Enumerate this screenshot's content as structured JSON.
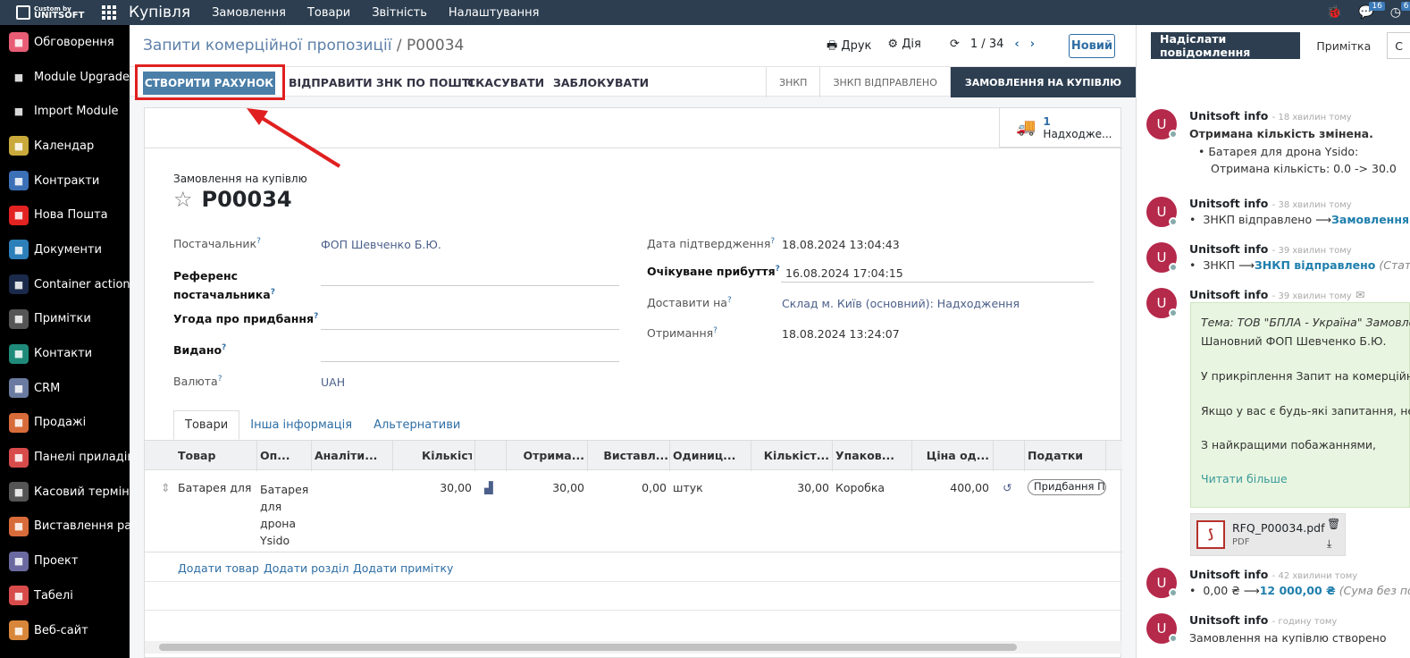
{
  "topbar": {
    "logo_small": "Custom by",
    "logo_big": "UNITSOFT",
    "app_title": "Купівля",
    "menu": [
      "Замовлення",
      "Товари",
      "Звітність",
      "Налаштування"
    ],
    "chat_count": "16",
    "activity_count": "6"
  },
  "sidebar": {
    "items": [
      {
        "label": "Обговорення",
        "icon": "discuss-icon",
        "color": "#e85d75"
      },
      {
        "label": "Module Upgrade",
        "icon": "upgrade-icon",
        "color": "#000000"
      },
      {
        "label": "Import Module",
        "icon": "import-icon",
        "color": "#000000"
      },
      {
        "label": "Календар",
        "icon": "calendar-icon",
        "color": "#c9a93b"
      },
      {
        "label": "Контракти",
        "icon": "contract-icon",
        "color": "#3b6fb6"
      },
      {
        "label": "Нова Пошта",
        "icon": "nova-poshta-icon",
        "color": "#e32222"
      },
      {
        "label": "Документи",
        "icon": "documents-icon",
        "color": "#2c7fb8"
      },
      {
        "label": "Container actions",
        "icon": "container-icon",
        "color": "#1b2a4a"
      },
      {
        "label": "Примітки",
        "icon": "notes-icon",
        "color": "#555555"
      },
      {
        "label": "Контакти",
        "icon": "contacts-icon",
        "color": "#1f8a7a"
      },
      {
        "label": "CRM",
        "icon": "crm-icon",
        "color": "#6a7aa0"
      },
      {
        "label": "Продажі",
        "icon": "sales-icon",
        "color": "#d86b3a"
      },
      {
        "label": "Панелі приладів",
        "icon": "dashboard-icon",
        "color": "#d84b4b"
      },
      {
        "label": "Касовий термін...",
        "icon": "pos-icon",
        "color": "#555555"
      },
      {
        "label": "Виставлення ра...",
        "icon": "invoice-icon",
        "color": "#d86b3a"
      },
      {
        "label": "Проект",
        "icon": "project-icon",
        "color": "#6a6aa0"
      },
      {
        "label": "Табелі",
        "icon": "timesheet-icon",
        "color": "#d84b4b"
      },
      {
        "label": "Веб-сайт",
        "icon": "website-icon",
        "color": "#d8863a"
      }
    ]
  },
  "control_panel": {
    "breadcrumb_parent": "Запити комерційної пропозиції",
    "breadcrumb_sep": "/",
    "breadcrumb_current": "P00034",
    "print_label": "Друк",
    "action_label": "Дія",
    "pager": "1 / 34",
    "new_label": "Новий"
  },
  "statusbar": {
    "create_invoice": "СТВОРИТИ РАХУНОК",
    "send_email": "ВІДПРАВИТИ ЗНК ПО ПОШТІ",
    "cancel": "СКАСУВАТИ",
    "lock": "ЗАБЛОКУВАТИ",
    "stages": [
      "ЗНКП",
      "ЗНКП ВІДПРАВЛЕНО",
      "ЗАМОВЛЕННЯ НА КУПІВЛЮ"
    ]
  },
  "smart_button": {
    "count": "1",
    "label": "Надходже..."
  },
  "form": {
    "doc_type": "Замовлення на купівлю",
    "doc_name": "P00034",
    "left_fields": [
      {
        "label": "Постачальник",
        "value": "ФОП Шевченко Б.Ю.",
        "bold": false
      },
      {
        "label": "Референс",
        "label2": "постачальника",
        "value": "",
        "bold": true
      },
      {
        "label": "Угода про придбання",
        "value": "",
        "bold": true
      },
      {
        "label": "Видано",
        "value": "",
        "bold": true
      },
      {
        "label": "Валюта",
        "value": "UAH",
        "bold": false
      }
    ],
    "right_fields": [
      {
        "label": "Дата підтвердження",
        "value": "18.08.2024 13:04:43"
      },
      {
        "label": "Очікуване прибуття",
        "value": "16.08.2024 17:04:15"
      },
      {
        "label": "Доставити на",
        "value": "Склад м. Київ (основний): Надходження"
      },
      {
        "label": "Отримання",
        "value": "18.08.2024 13:24:07"
      }
    ],
    "tabs": [
      "Товари",
      "Інша інформація",
      "Альтернативи"
    ]
  },
  "table": {
    "headers": [
      "Товар",
      "Оп...",
      "Аналіти...",
      "Кількість",
      "Отрима...",
      "Виставл...",
      "Одиниц...",
      "Кількіст...",
      "Упаков...",
      "Ціна од...",
      "Податки"
    ],
    "row": {
      "product": "Батарея для ...",
      "description": [
        "Батарея",
        "для",
        "дрона",
        "Ysido"
      ],
      "qty": "30,00",
      "received": "30,00",
      "invoiced": "0,00",
      "uom": "штук",
      "pack_qty": "30,00",
      "packaging": "Коробка",
      "price": "400,00",
      "tax": "Придбання ПДВ"
    },
    "add_product": "Додати товар",
    "add_section": "Додати розділ",
    "add_note": "Додати примітку"
  },
  "chatter": {
    "send_message": "Надіслати повідомлення",
    "log_note": "Примітка",
    "cut_btn": "С",
    "messages": [
      {
        "author": "Unitsoft info",
        "time": "- 18 хвилин тому",
        "lines": [
          "Отримана кількість змінена.",
          "Батарея для дрона Ysido:",
          "Отримана кількість: 0.0 -> 30.0"
        ]
      },
      {
        "author": "Unitsoft info",
        "time": "- 38 хвилин тому",
        "from": "ЗНКП відправлено",
        "to": "Замовлення"
      },
      {
        "author": "Unitsoft info",
        "time": "- 39 хвилин тому",
        "from": "ЗНКП",
        "to": "ЗНКП відправлено",
        "note": "(Стат"
      },
      {
        "author": "Unitsoft info",
        "time": "- 39 хвилин тому"
      },
      {
        "author": "Unitsoft info",
        "time": "- 42 хвилини тому",
        "from": "0,00 ₴",
        "to": "12 000,00 ₴",
        "note": "(Сума без под"
      },
      {
        "author": "Unitsoft info",
        "time": "- годину тому",
        "text": "Замовлення на купівлю створено"
      }
    ],
    "mail": {
      "subject": "Тема: ТОВ \"БПЛА - Україна\" Замовлен",
      "greeting": "Шановний ФОП Шевченко Б.Ю.",
      "body1": "У прикріплення Запит на комерційну",
      "body2": "Якщо у вас є будь-які запитання, не со",
      "regards": "З найкращими побажаннями,",
      "read_more": "Читати більше"
    },
    "attachment": {
      "name": "RFQ_P00034.pdf",
      "type": "PDF"
    }
  }
}
